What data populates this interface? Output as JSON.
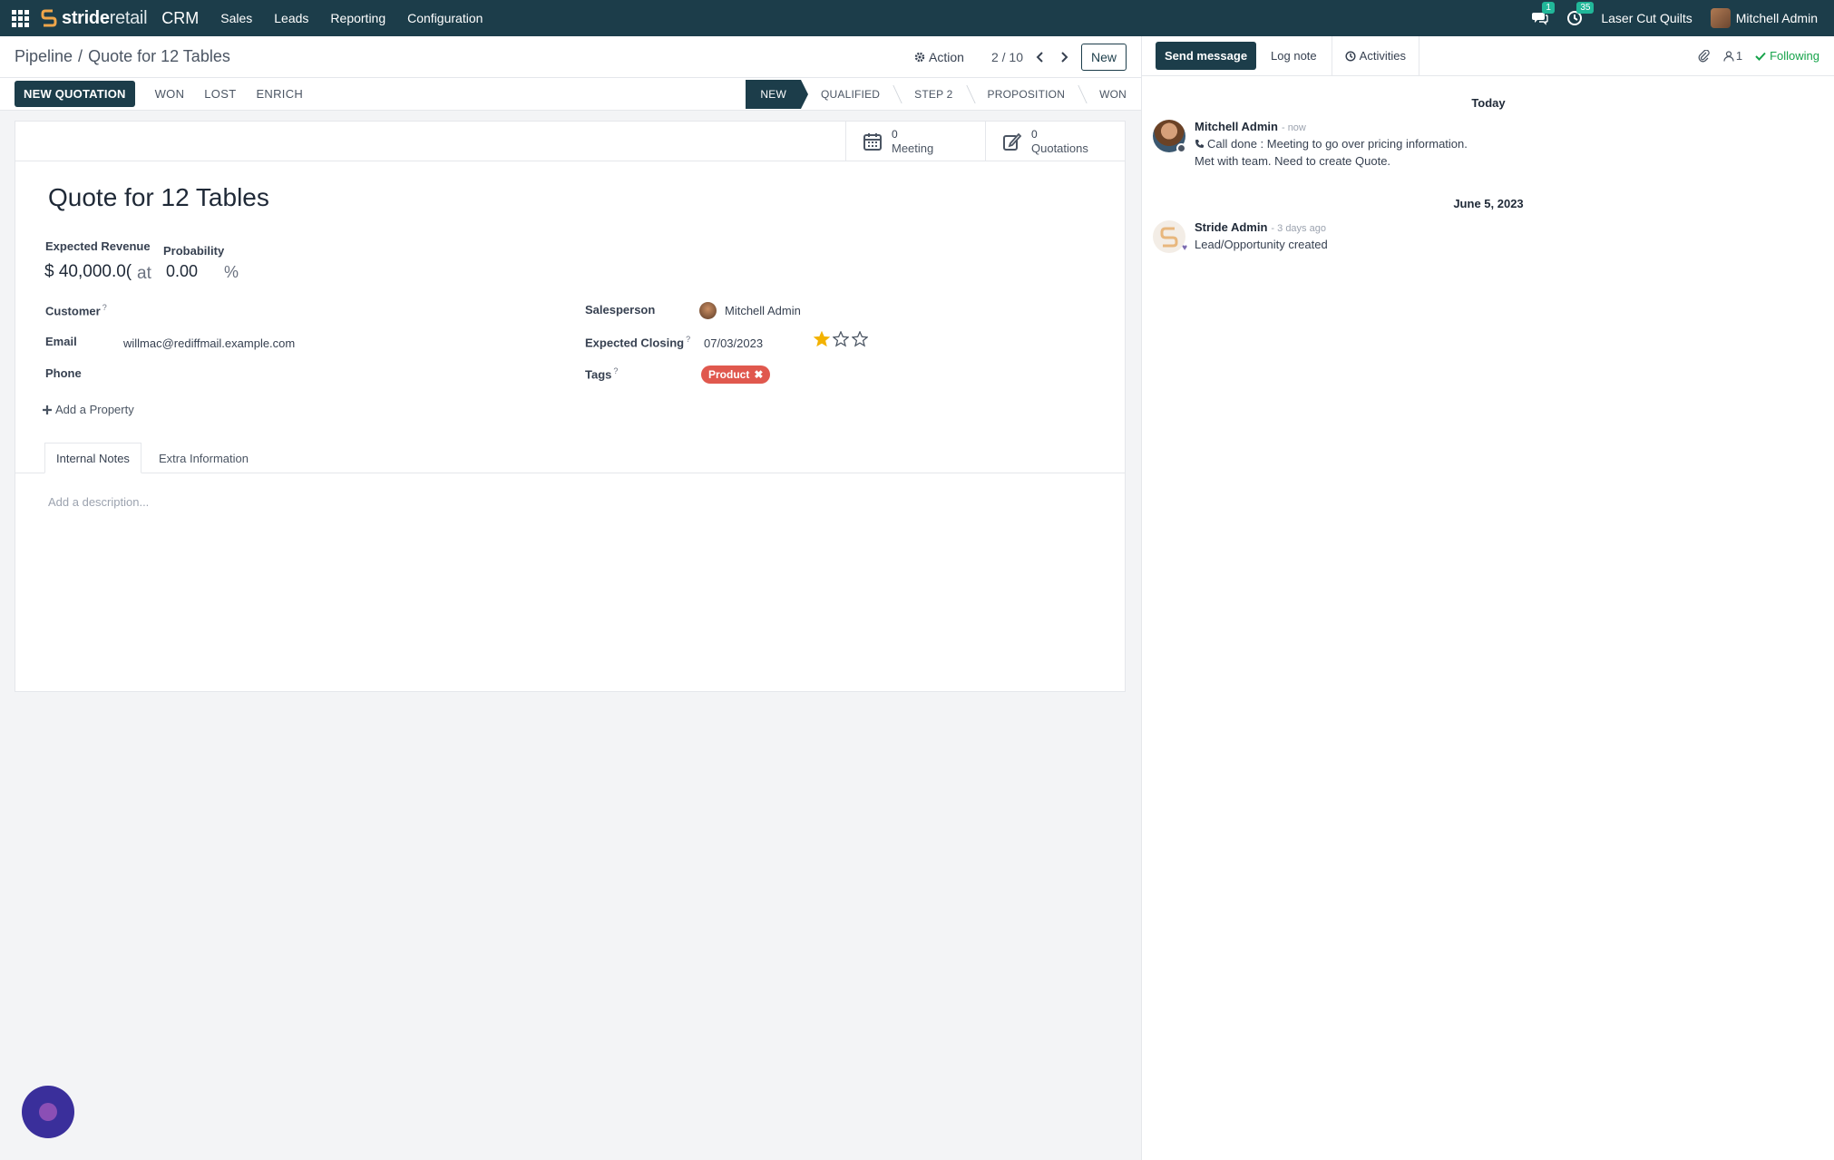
{
  "topbar": {
    "brand_bold": "stride",
    "brand_light": "retail",
    "app": "CRM",
    "menu": [
      "Sales",
      "Leads",
      "Reporting",
      "Configuration"
    ],
    "messages_badge": "1",
    "activities_badge": "35",
    "company": "Laser Cut Quilts",
    "user": "Mitchell Admin"
  },
  "control": {
    "breadcrumb_parent": "Pipeline",
    "breadcrumb_current": "Quote for 12 Tables",
    "action_label": "Action",
    "pager": "2 / 10",
    "new_label": "New"
  },
  "header": {
    "new_quotation": "NEW QUOTATION",
    "won": "WON",
    "lost": "LOST",
    "enrich": "ENRICH",
    "stages": [
      "NEW",
      "QUALIFIED",
      "STEP 2",
      "PROPOSITION",
      "WON"
    ],
    "active_stage": "NEW"
  },
  "stat_buttons": {
    "meeting_count": "0",
    "meeting_label": "Meeting",
    "quotation_count": "0",
    "quotation_label": "Quotations"
  },
  "form": {
    "title": "Quote for 12 Tables",
    "expected_revenue_label": "Expected Revenue",
    "expected_revenue": "$ 40,000.0(",
    "at": "at",
    "probability_label": "Probability",
    "probability": "0.00",
    "percent": "%",
    "customer_label": "Customer",
    "email_label": "Email",
    "email": "willmac@rediffmail.example.com",
    "phone_label": "Phone",
    "salesperson_label": "Salesperson",
    "salesperson": "Mitchell Admin",
    "closing_label": "Expected Closing",
    "closing": "07/03/2023",
    "priority_stars": 1,
    "priority_max": 3,
    "tags_label": "Tags",
    "tag": "Product",
    "add_property": "Add a Property",
    "help_mark": "?"
  },
  "tabs": {
    "internal_notes": "Internal Notes",
    "extra_info": "Extra Information"
  },
  "notes": {
    "placeholder": "Add a description..."
  },
  "chatter": {
    "send_message": "Send message",
    "log_note": "Log note",
    "activities": "Activities",
    "followers": "1",
    "following": "Following",
    "date_today": "Today",
    "date_older": "June 5, 2023",
    "messages": [
      {
        "author": "Mitchell Admin",
        "time": "- now",
        "line1": "Call done : Meeting to go over pricing information.",
        "line2": "Met with team. Need to create Quote."
      },
      {
        "author": "Stride Admin",
        "time": "- 3 days ago",
        "line1": "Lead/Opportunity created",
        "line2": ""
      }
    ]
  },
  "colors": {
    "primary": "#1c3d4a",
    "tag": "#e0584e",
    "following": "#16a34a",
    "star": "#f3b200"
  }
}
